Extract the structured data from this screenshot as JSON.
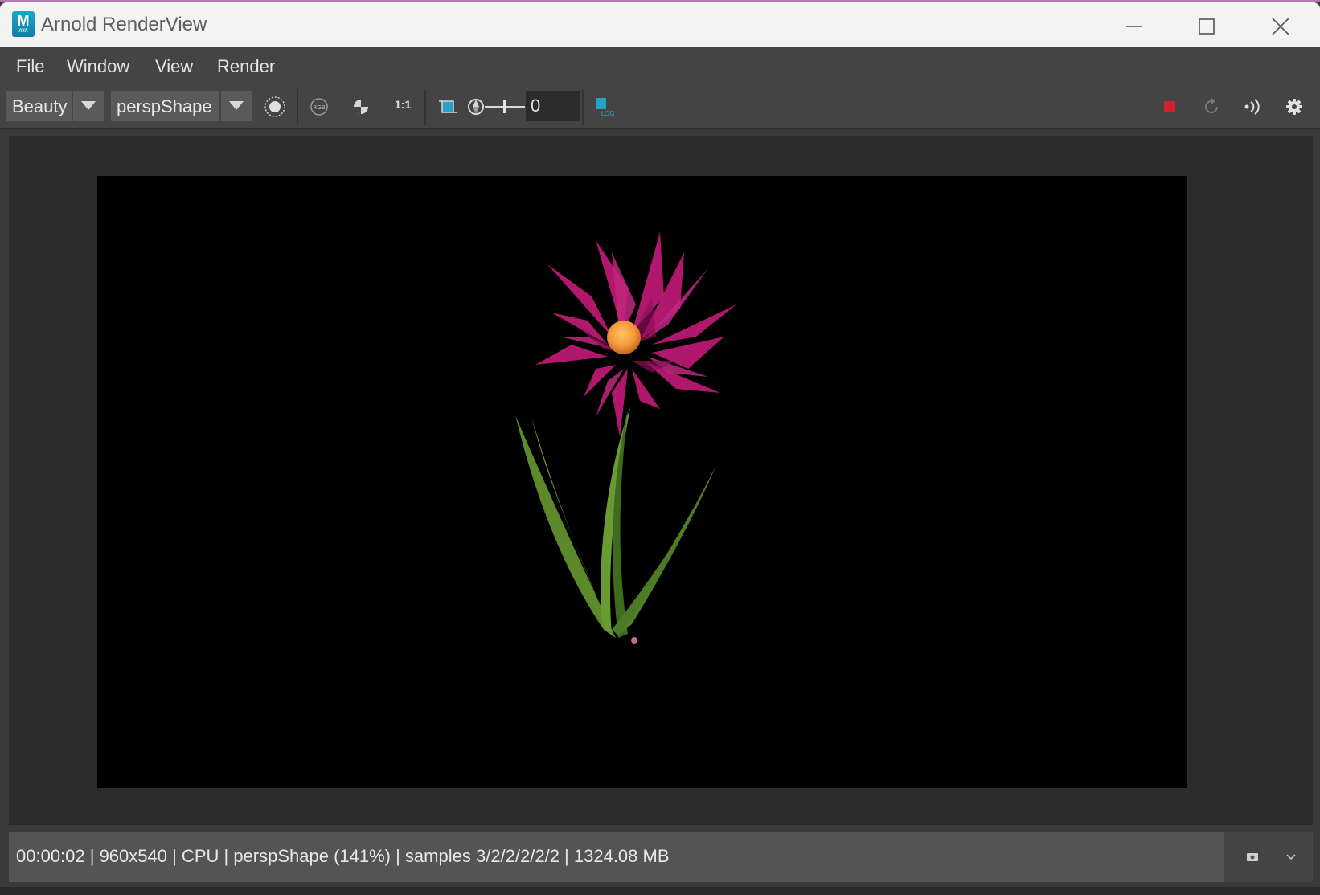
{
  "window": {
    "title": "Arnold RenderView",
    "logo_letter": "M",
    "logo_sub": "AYA"
  },
  "menu": [
    {
      "label": "File"
    },
    {
      "label": "Window"
    },
    {
      "label": "View"
    },
    {
      "label": "Render"
    }
  ],
  "toolbar": {
    "aov_dropdown": "Beauty",
    "camera_dropdown": "perspShape",
    "ratio_label": "1:1",
    "rgb_label": "RGB",
    "log_label": "LOG",
    "exposure_value": "0",
    "icons": [
      "display-mode-icon",
      "rgb-channel-icon",
      "alpha-channel-icon",
      "ratio-1to1-icon",
      "region-crop-icon",
      "exposure-icon",
      "log-icon",
      "stop-render-icon",
      "refresh-render-icon",
      "ipr-icon",
      "settings-gear-icon"
    ],
    "stop_color": "#d4202a"
  },
  "render": {
    "subject": "flower",
    "petal_color": "#b0186e",
    "center_color": "#f39a3b",
    "stem_color": "#5c8a2a"
  },
  "status": {
    "text": "00:00:02 | 960x540 | CPU | perspShape (141%) | samples 3/2/2/2/2/2 | 1324.08 MB"
  }
}
